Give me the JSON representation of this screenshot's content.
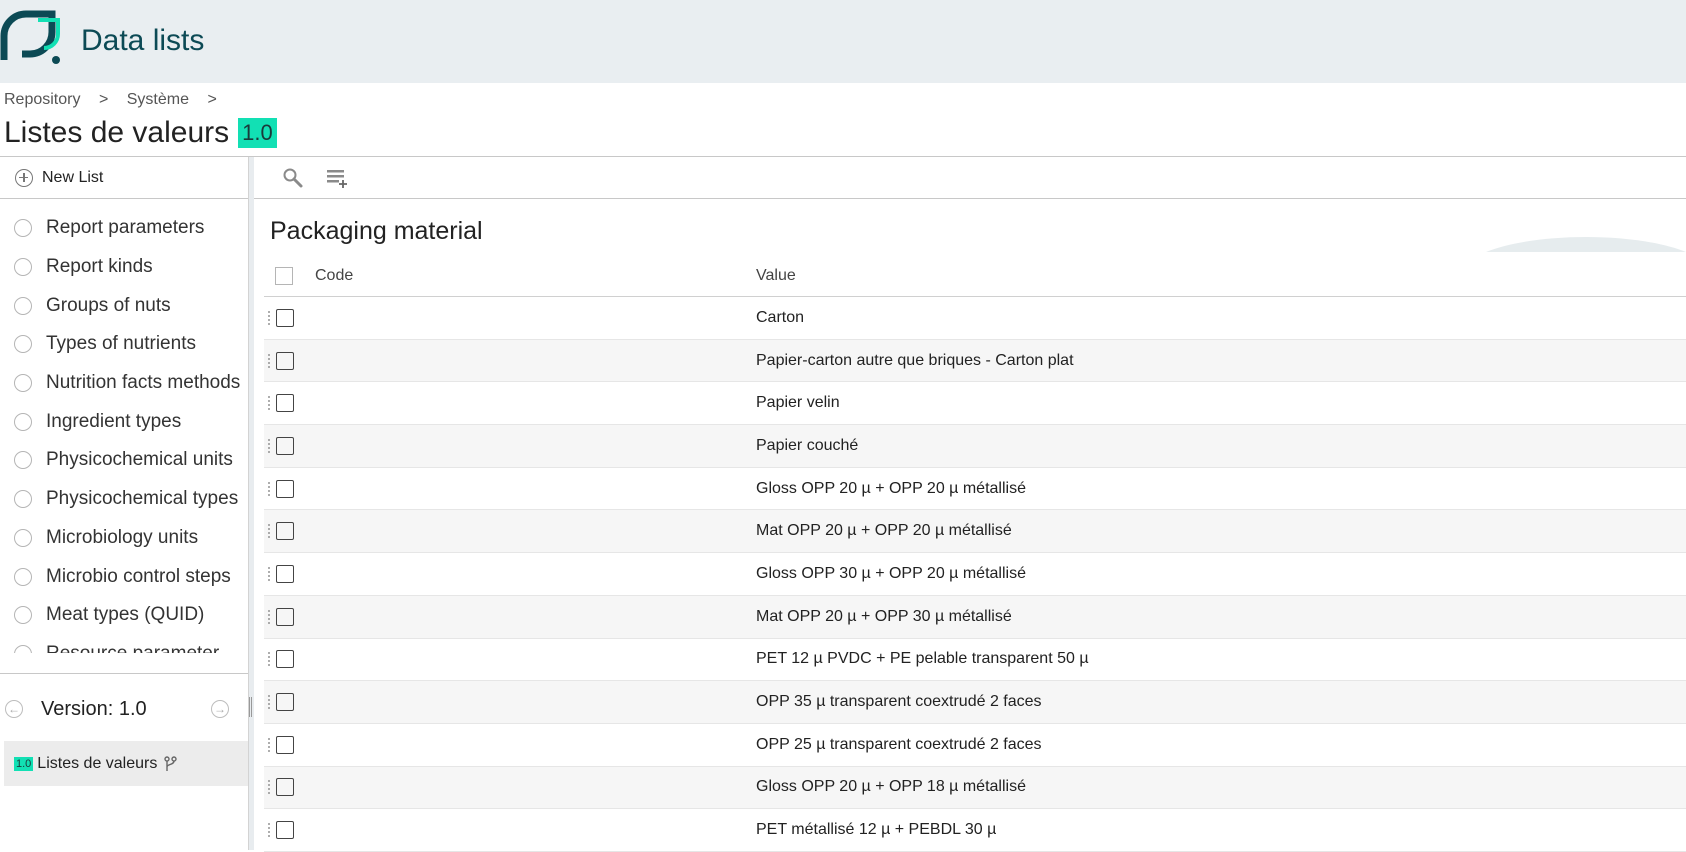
{
  "header": {
    "title": "Data lists"
  },
  "breadcrumb": [
    "Repository",
    ">",
    "Système",
    ">"
  ],
  "page": {
    "title": "Listes de valeurs",
    "version_badge": "1.0"
  },
  "sidebar": {
    "new_list_label": "New List",
    "items": [
      "Report parameters",
      "Report kinds",
      "Groups of nuts",
      "Types of nutrients",
      "Nutrition facts methods",
      "Ingredient types",
      "Physicochemical units",
      "Physicochemical types",
      "Microbiology units",
      "Microbio control steps",
      "Meat types (QUID)",
      "Resource parameter"
    ],
    "version_label": "Version: 1.0",
    "version_node": {
      "badge": "1.0",
      "label": "Listes de valeurs"
    }
  },
  "toolbar": {
    "icons": [
      "search-icon",
      "add-row-icon"
    ]
  },
  "main": {
    "list_title": "Packaging material",
    "columns": {
      "code": "Code",
      "value": "Value"
    },
    "rows": [
      "Carton",
      "Papier-carton autre que briques - Carton plat",
      "Papier velin",
      "Papier couché",
      "Gloss OPP 20 µ + OPP 20 µ métallisé",
      "Mat OPP 20 µ + OPP 20 µ métallisé",
      "Gloss OPP 30 µ + OPP 20 µ métallisé",
      "Mat OPP 20 µ + OPP 30 µ métallisé",
      "PET 12 µ PVDC + PE pelable transparent 50 µ",
      "OPP 35 µ transparent coextrudé 2 faces",
      "OPP 25 µ transparent coextrudé 2 faces",
      "Gloss OPP 20 µ + OPP 18 µ métallisé",
      "PET métallisé 12 µ + PEBDL 30 µ"
    ]
  },
  "colors": {
    "accent": "#12e0b4",
    "brand": "#0c4a55",
    "header_bg": "#e9eef1"
  }
}
